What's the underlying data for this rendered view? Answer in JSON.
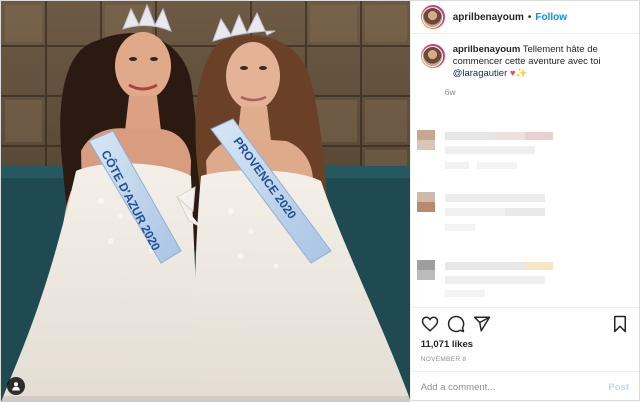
{
  "post": {
    "username": "aprilbenayoum",
    "follow_separator": "•",
    "follow_label": "Follow",
    "caption": {
      "username": "aprilbenayoum",
      "text": "Tellement hâte de commencer cette aventure avec toi",
      "mention": "@laragautier",
      "emoji_heart": "♥",
      "emoji_sparkle": "✨",
      "age": "6w"
    },
    "likes": "11,071 likes",
    "date": "NOVEMBER 8",
    "comment_placeholder": "Add a comment...",
    "post_label": "Post"
  },
  "photo": {
    "sash_left": "CÔTE D'AZUR 2020",
    "sash_right": "PROVENCE 2020"
  },
  "icons": {
    "like": "heart-icon",
    "comment": "comment-icon",
    "share": "share-icon",
    "save": "bookmark-icon",
    "tags": "user-tag-icon"
  },
  "colors": {
    "follow": "#0095f6",
    "heart": "#ed4956",
    "mention": "#00376b",
    "post_disabled": "#b2dffc"
  }
}
